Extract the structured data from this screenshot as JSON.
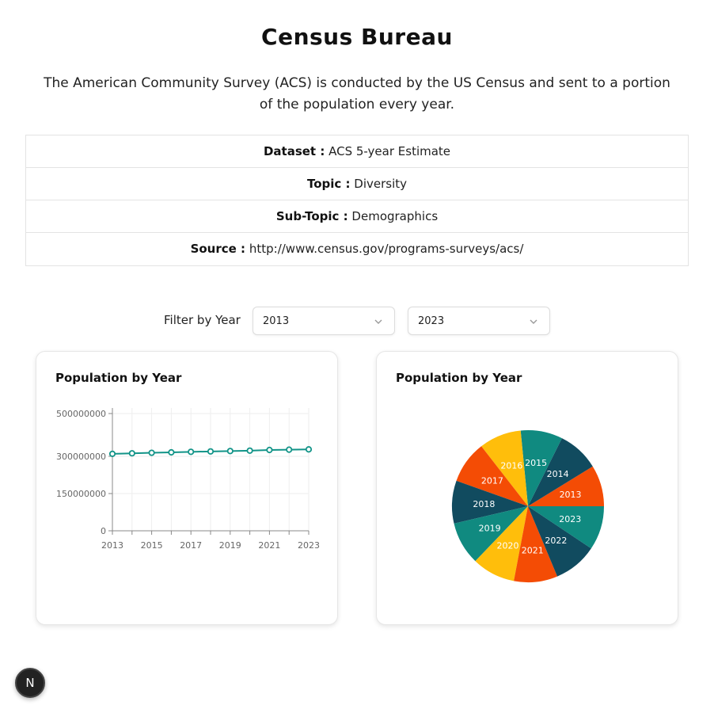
{
  "header": {
    "title": "Census Bureau",
    "intro": "The American Community Survey (ACS) is conducted by the US Census and sent to a portion of the population every year."
  },
  "info": [
    {
      "key": "Dataset :",
      "value": "ACS 5-year Estimate"
    },
    {
      "key": "Topic :",
      "value": "Diversity"
    },
    {
      "key": "Sub-Topic :",
      "value": "Demographics"
    },
    {
      "key": "Source :",
      "value": "http://www.census.gov/programs-surveys/acs/"
    }
  ],
  "filter": {
    "label": "Filter by Year",
    "start_year": "2013",
    "end_year": "2023"
  },
  "nav_badge": "N",
  "colors": {
    "line": "#129488",
    "pie": [
      "#f44c05",
      "#114b5f",
      "#108a80",
      "#ffbe0b"
    ]
  },
  "chart_data": [
    {
      "type": "line",
      "title": "Population by Year",
      "categories": [
        "2013",
        "2014",
        "2015",
        "2016",
        "2017",
        "2018",
        "2019",
        "2020",
        "2021",
        "2022",
        "2023"
      ],
      "x_tick_labels": [
        "2013",
        "2015",
        "2017",
        "2019",
        "2021",
        "2023"
      ],
      "y_ticks": [
        "0",
        "150000000",
        "300000000",
        "500000000"
      ],
      "ylim": [
        0,
        500000000
      ],
      "grid": true,
      "series": [
        {
          "values": [
            311536594,
            314107084,
            316515021,
            318558162,
            321004407,
            322903030,
            324697795,
            326569308,
            329725481,
            331097593,
            332387540
          ]
        }
      ]
    },
    {
      "type": "pie",
      "title": "Population by Year",
      "labels": [
        "2013",
        "2014",
        "2015",
        "2016",
        "2017",
        "2018",
        "2019",
        "2020",
        "2021",
        "2022",
        "2023"
      ],
      "values": [
        311536594,
        314107084,
        316515021,
        318558162,
        321004407,
        322903030,
        324697795,
        326569308,
        329725481,
        331097593,
        332387540
      ]
    }
  ]
}
